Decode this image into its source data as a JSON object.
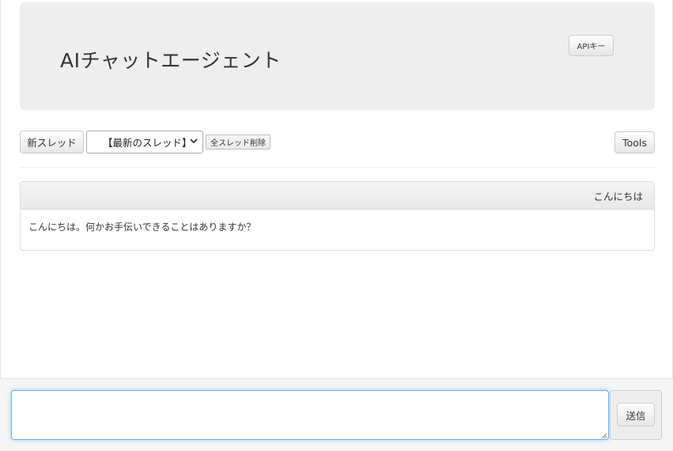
{
  "header": {
    "title": "AIチャットエージェント",
    "api_key_label": "APIキー"
  },
  "toolbar": {
    "new_thread_label": "新スレッド",
    "thread_select_value": "【最新のスレッド】",
    "delete_all_label": "全スレッド削除",
    "tools_label": "Tools"
  },
  "chat": {
    "messages": [
      {
        "user_text": "こんにちは",
        "assistant_text": "こんにちは。何かお手伝いできることはありますか？"
      }
    ]
  },
  "composer": {
    "input_value": "",
    "send_label": "送信"
  },
  "icons": {
    "select_chevron": "chevron-down-icon",
    "resize_grip": "resize-grip-icon"
  },
  "colors": {
    "jumbotron_bg": "#eeeeee",
    "input_focus": "#66afe9",
    "footer_bg": "#f5f5f5"
  }
}
